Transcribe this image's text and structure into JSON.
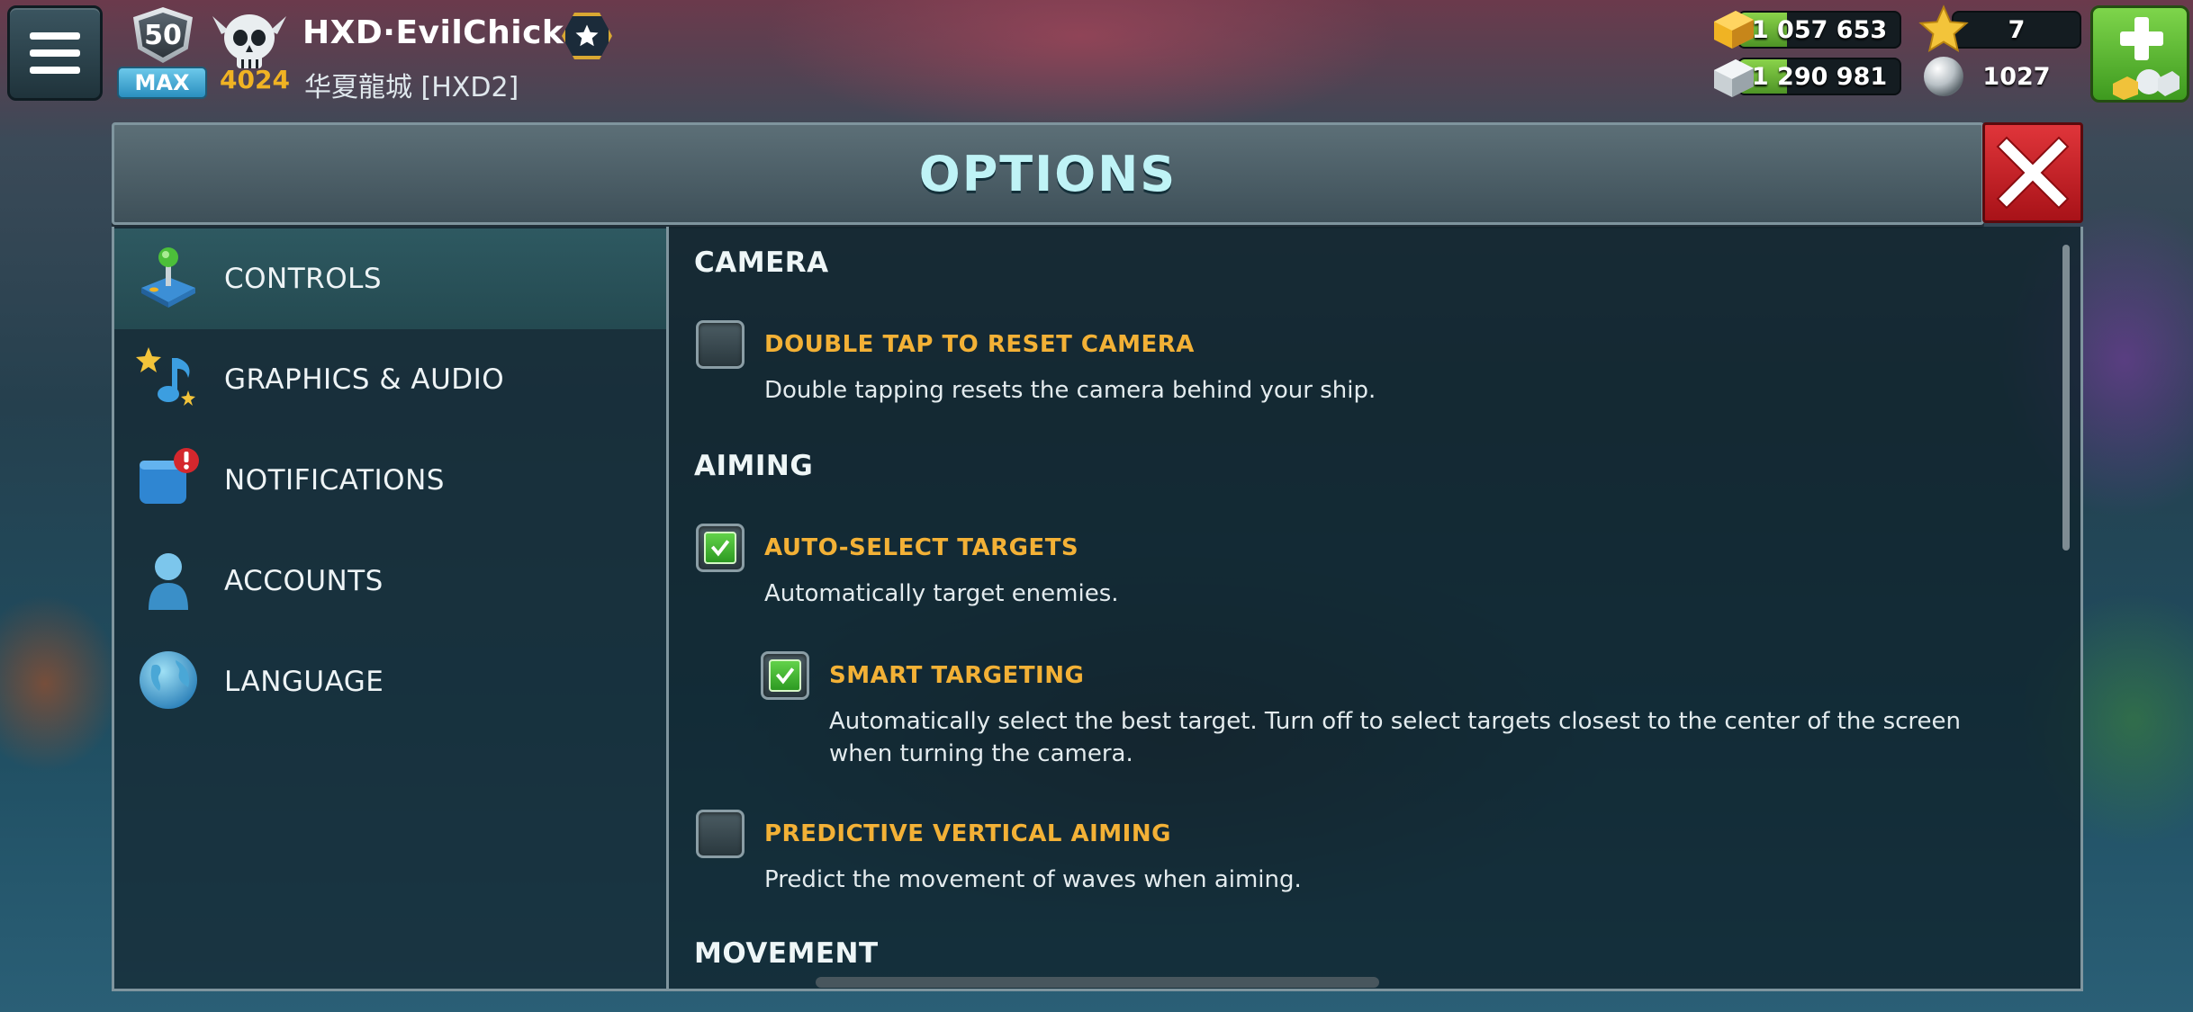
{
  "hud": {
    "menu_icon": "hamburger-menu-icon",
    "player": {
      "rank": "50",
      "rank_tag": "MAX",
      "level_value": "4024",
      "name": "HXD·EvilChicken",
      "guild": "华夏龍城 [HXD2]"
    },
    "resources": {
      "gold": "1 057 653",
      "silver": "1 290 981",
      "stars": "7",
      "pearls": "1027"
    }
  },
  "options": {
    "title": "OPTIONS",
    "sidebar": [
      {
        "label": "CONTROLS",
        "icon": "joystick-icon",
        "active": true
      },
      {
        "label": "GRAPHICS & AUDIO",
        "icon": "music-note-icon",
        "active": false
      },
      {
        "label": "NOTIFICATIONS",
        "icon": "notification-icon",
        "active": false
      },
      {
        "label": "ACCOUNTS",
        "icon": "account-icon",
        "active": false
      },
      {
        "label": "LANGUAGE",
        "icon": "globe-icon",
        "active": false
      }
    ],
    "sections": {
      "camera": {
        "title": "CAMERA",
        "double_tap": {
          "title": "DOUBLE TAP TO RESET CAMERA",
          "desc": "Double tapping resets the camera behind your ship.",
          "checked": false
        }
      },
      "aiming": {
        "title": "AIMING",
        "auto_select": {
          "title": "AUTO-SELECT TARGETS",
          "desc": "Automatically target enemies.",
          "checked": true
        },
        "smart_targeting": {
          "title": "SMART TARGETING",
          "desc": "Automatically select the best target. Turn off to select targets closest to the center of the screen when turning the camera.",
          "checked": true
        },
        "predictive": {
          "title": "PREDICTIVE VERTICAL AIMING",
          "desc": "Predict the movement of waves when aiming.",
          "checked": false
        }
      },
      "movement": {
        "title": "MOVEMENT"
      }
    }
  },
  "colors": {
    "accent_orange": "#f3b136",
    "title_cyan": "#bff3f6",
    "close_red": "#d0242a",
    "check_green": "#3eb52c"
  }
}
